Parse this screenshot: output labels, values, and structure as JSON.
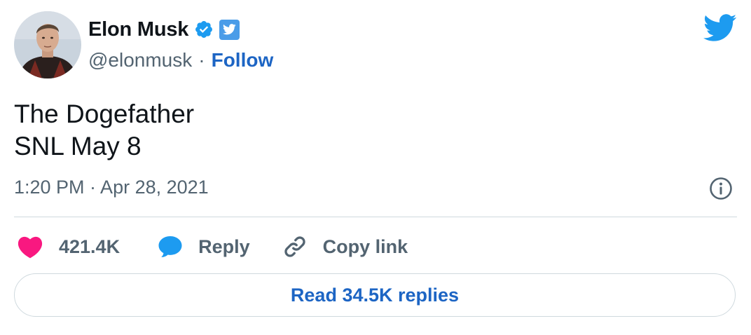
{
  "tweet": {
    "author": {
      "display_name": "Elon Musk",
      "handle": "@elonmusk",
      "separator": "·",
      "follow_label": "Follow",
      "verified": true
    },
    "text_lines": [
      "The Dogefather",
      "SNL May 8"
    ],
    "timestamp": "1:20 PM · Apr 28, 2021",
    "actions": {
      "likes_count": "421.4K",
      "reply_label": "Reply",
      "copy_link_label": "Copy link"
    },
    "read_replies_label": "Read 34.5K replies"
  },
  "colors": {
    "brand_blue": "#1d9bf0",
    "link_blue": "#1d65c4",
    "heart_pink": "#f91880",
    "secondary_text": "#536471",
    "divider": "#cfd9de"
  },
  "icons": {
    "brand": "twitter-bird-icon",
    "verified": "verified-badge-icon",
    "info": "info-icon",
    "like": "heart-icon",
    "reply": "speech-bubble-icon",
    "copy": "link-icon"
  }
}
